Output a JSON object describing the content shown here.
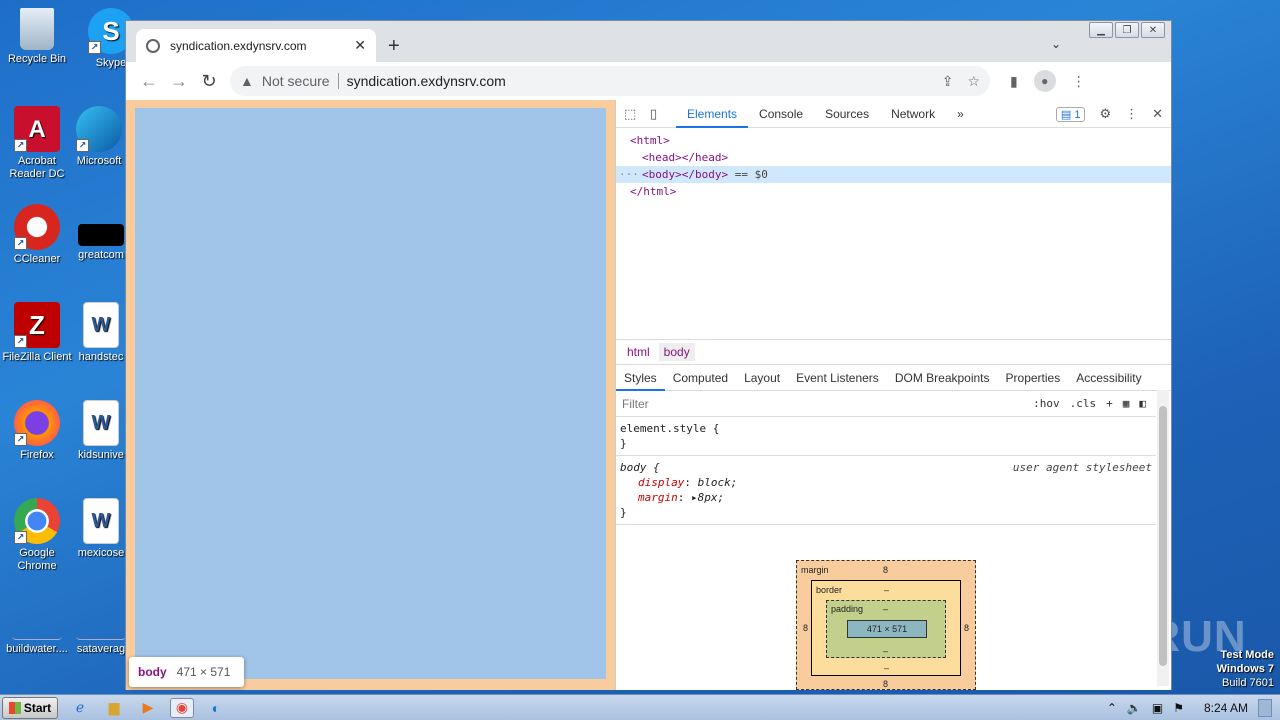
{
  "desktop": {
    "icons": [
      {
        "label": "Recycle Bin",
        "icon": "recycle-bin-icon"
      },
      {
        "label": "Skype",
        "icon": "skype-icon"
      },
      {
        "label": "Acrobat Reader DC",
        "icon": "acrobat-icon"
      },
      {
        "label": "Microsoft",
        "icon": "edge-icon"
      },
      {
        "label": "CCleaner",
        "icon": "ccleaner-icon"
      },
      {
        "label": "greatcom",
        "icon": "file-icon"
      },
      {
        "label": "FileZilla Client",
        "icon": "filezilla-icon"
      },
      {
        "label": "handstec",
        "icon": "word-doc-icon"
      },
      {
        "label": "Firefox",
        "icon": "firefox-icon"
      },
      {
        "label": "kidsunive",
        "icon": "word-doc-icon"
      },
      {
        "label": "Google Chrome",
        "icon": "chrome-icon"
      },
      {
        "label": "mexicose",
        "icon": "word-doc-icon"
      },
      {
        "label": "buildwater....",
        "icon": "file-icon"
      },
      {
        "label": "sataverag",
        "icon": "file-icon"
      }
    ]
  },
  "browser": {
    "tab_title": "syndication.exdynsrv.com",
    "security": "Not secure",
    "url": "syndication.exdynsrv.com"
  },
  "page": {
    "tooltip_tag": "body",
    "tooltip_dims": "471 × 571"
  },
  "devtools": {
    "tabs": [
      "Elements",
      "Console",
      "Sources",
      "Network"
    ],
    "issues_count": "1",
    "dom": {
      "html_open": "<html>",
      "head": "<head></head>",
      "body": "<body></body>",
      "body_ref": "== $0",
      "html_close": "</html>"
    },
    "breadcrumbs": [
      "html",
      "body"
    ],
    "subtabs": [
      "Styles",
      "Computed",
      "Layout",
      "Event Listeners",
      "DOM Breakpoints",
      "Properties",
      "Accessibility"
    ],
    "filter_placeholder": "Filter",
    "hov": ":hov",
    "cls": ".cls",
    "element_style": "element.style {",
    "close_brace": "}",
    "body_selector": "body {",
    "ua_source": "user agent stylesheet",
    "props": [
      {
        "name": "display",
        "value": "block;"
      },
      {
        "name": "margin",
        "value": "8px;"
      }
    ],
    "boxmodel": {
      "margin_label": "margin",
      "margin_top": "8",
      "margin_bottom": "8",
      "margin_left": "8",
      "margin_right": "8",
      "border_label": "border",
      "border_top": "–",
      "border_bottom": "–",
      "padding_label": "padding",
      "padding_top": "–",
      "padding_bottom": "–",
      "content": "471 × 571"
    }
  },
  "taskbar": {
    "start_label": "Start",
    "clock": "8:24 AM"
  },
  "watermark": {
    "line1": "Test Mode",
    "line2": "Windows 7",
    "line3": "Build 7601",
    "brand": "ANY RUN"
  }
}
